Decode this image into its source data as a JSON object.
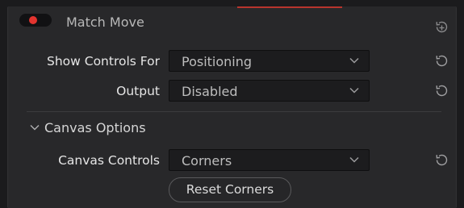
{
  "header": {
    "title": "Match Move",
    "toggle_on": true
  },
  "rows": {
    "show_controls": {
      "label": "Show Controls For",
      "value": "Positioning"
    },
    "output": {
      "label": "Output",
      "value": "Disabled"
    },
    "canvas_controls": {
      "label": "Canvas Controls",
      "value": "Corners"
    }
  },
  "section": {
    "label": "Canvas Options"
  },
  "buttons": {
    "reset_corners": "Reset Corners"
  },
  "colors": {
    "toggle_dot": "#e3342f",
    "panel_bg": "#28282a",
    "dropdown_bg": "#1c1c1e"
  },
  "icons": {
    "header_reset": "reset-icon",
    "row_reset": "reset-icon",
    "dropdown_chevron": "chevron-down-icon",
    "section_chevron": "chevron-down-icon"
  }
}
